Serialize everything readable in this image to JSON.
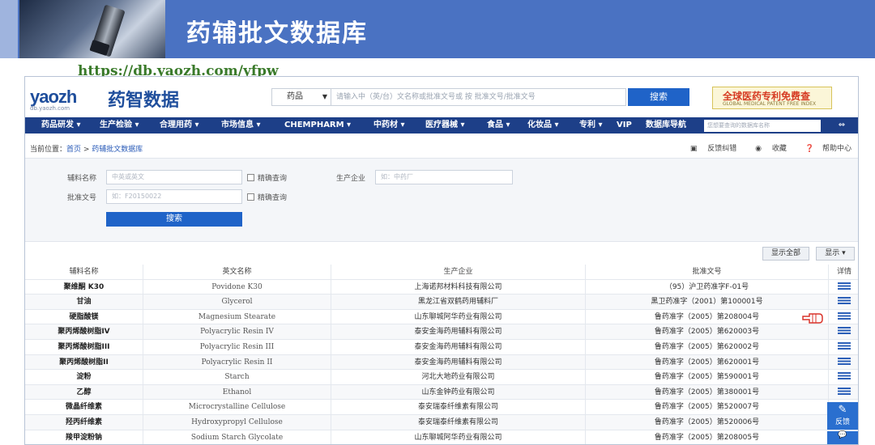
{
  "slide": {
    "title": "药辅批文数据库",
    "url": "https://db.yaozh.com/yfpw"
  },
  "header": {
    "logo_latin": "yaozh",
    "logo_sub": "db.yaozh.com",
    "logo_cn": "药智数据",
    "category_select": "药品",
    "search_placeholder": "请输入中（英/台）文名称或批准文号或 按 批准文号/批准文号",
    "search_button": "搜索",
    "promo_main": "全球医药专利免费查",
    "promo_sub": "GLOBAL MEDICAL PATENT FREE INDEX"
  },
  "nav": {
    "items": [
      "药品研发 ▾",
      "生产检验 ▾",
      "合理用药 ▾",
      "市场信息 ▾",
      "CHEMPHARM ▾",
      "中药材 ▾",
      "医疗器械 ▾",
      "食品 ▾",
      "化妆品 ▾",
      "专利 ▾",
      "VIP",
      "数据库导航"
    ],
    "search_placeholder": "您想要查询的数据库名称",
    "menu_icon": "⇔"
  },
  "breadcrumb": {
    "prefix": "当前位置：",
    "home": "首页",
    "sep": " > ",
    "current": "药辅批文数据库"
  },
  "tools": {
    "feedback": "反馈纠错",
    "favorite": "收藏",
    "help": "帮助中心"
  },
  "filter": {
    "name_label": "辅料名称",
    "name_placeholder": "中英或英文",
    "exact_match": "精确查询",
    "company_label": "生产企业",
    "company_placeholder": "如：中药厂",
    "approval_label": "批准文号",
    "approval_placeholder": "如：F20150022",
    "exact_approval": "精确查询",
    "search_button": "搜索"
  },
  "results": {
    "show_all": "显示全部",
    "show": "显示 ▾",
    "columns": [
      "辅料名称",
      "英文名称",
      "生产企业",
      "批准文号",
      "详情"
    ],
    "rows": [
      [
        "聚维酮 K30",
        "Povidone K30",
        "上海诺邦材料科技有限公司",
        "（95）沪卫药准字F-01号"
      ],
      [
        "甘油",
        "Glycerol",
        "黑龙江省双鹤药用辅料厂",
        "黑卫药准字（2001）第100001号"
      ],
      [
        "硬脂酸镁",
        "Magnesium Stearate",
        "山东聊城阿华药业有限公司",
        "鲁药准字（2005）第208004号"
      ],
      [
        "聚丙烯酸树脂IV",
        "Polyacrylic Resin IV",
        "泰安金海药用辅料有限公司",
        "鲁药准字（2005）第620003号"
      ],
      [
        "聚丙烯酸树脂III",
        "Polyacrylic Resin III",
        "泰安金海药用辅料有限公司",
        "鲁药准字（2005）第620002号"
      ],
      [
        "聚丙烯酸树脂II",
        "Polyacrylic Resin II",
        "泰安金海药用辅料有限公司",
        "鲁药准字（2005）第620001号"
      ],
      [
        "淀粉",
        "Starch",
        "河北大地药业有限公司",
        "鲁药准字（2005）第590001号"
      ],
      [
        "乙醇",
        "Ethanol",
        "山东金钟药业有限公司",
        "鲁药准字（2005）第380001号"
      ],
      [
        "微晶纤维素",
        "Microcrystalline Cellulose",
        "泰安瑞泰纤维素有限公司",
        "鲁药准字（2005）第520007号"
      ],
      [
        "羟丙纤维素",
        "Hydroxypropyl Cellulose",
        "泰安瑞泰纤维素有限公司",
        "鲁药准字（2005）第520006号"
      ],
      [
        "羧甲淀粉钠",
        "Sodium Starch Glycolate",
        "山东聊城阿华药业有限公司",
        "鲁药准字（2005）第208005号"
      ]
    ]
  },
  "side": {
    "feedback_label": "反馈",
    "feedback_icon": "✎",
    "chat_icon": "💬"
  },
  "colors": {
    "slide_blue": "#4a72c2",
    "nav_blue": "#1d3f88",
    "button_blue": "#1f63c8",
    "link_blue": "#2a5bb8"
  }
}
